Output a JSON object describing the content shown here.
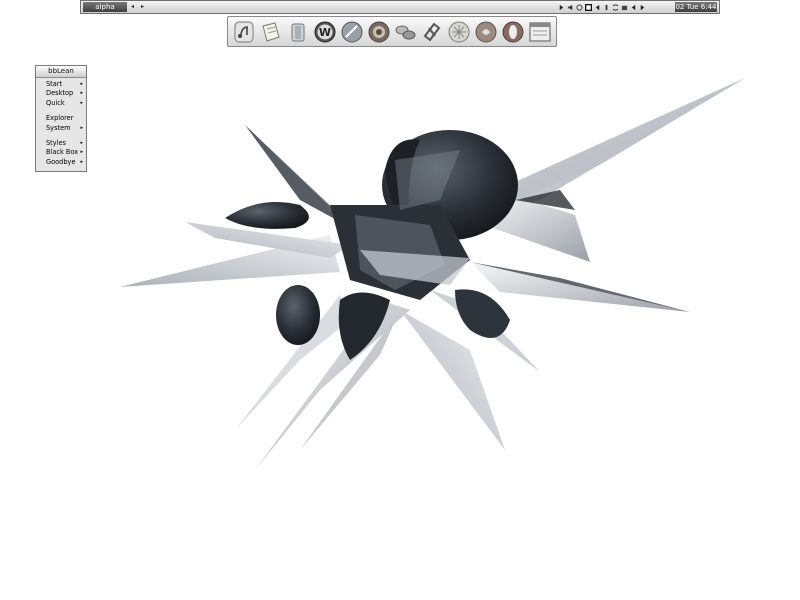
{
  "toolbar": {
    "workspace_label": "alpha",
    "prev_arrow": "◂",
    "next_arrow": "▸",
    "clock": "02 Tue 6:44",
    "tray_icons": [
      "tray-arrow-icon",
      "speaker-icon",
      "network-icon",
      "monitor-icon",
      "arrow-left-icon",
      "volume-icon",
      "keyboard-icon",
      "battery-icon",
      "tray-prev-icon",
      "tray-next-icon"
    ]
  },
  "dock": {
    "icons": [
      "itunes-icon",
      "notepad-icon",
      "recycle-bin-icon",
      "winamp-icon",
      "browser-icon",
      "firefox-icon",
      "network-tool-icon",
      "sync-icon",
      "grid-app-icon",
      "media-player-icon",
      "opera-icon",
      "window-app-icon"
    ]
  },
  "menu": {
    "title": "bbLean",
    "items": [
      {
        "label": "Start",
        "submenu": true
      },
      {
        "label": "Desktop",
        "submenu": true
      },
      {
        "label": "Quick",
        "submenu": true
      },
      {
        "label": "Explorer",
        "submenu": false
      },
      {
        "label": "System",
        "submenu": true
      },
      {
        "label": "Styles",
        "submenu": true
      },
      {
        "label": "Black Box",
        "submenu": true
      },
      {
        "label": "Goodbye",
        "submenu": true
      }
    ],
    "arrow_glyph": "▸"
  },
  "colors": {
    "accent_dark": "#3e3e3e",
    "panel_light": "#f4f4f4",
    "wallpaper_bg": "#ffffff",
    "shape_dark": "#2a2f36"
  }
}
